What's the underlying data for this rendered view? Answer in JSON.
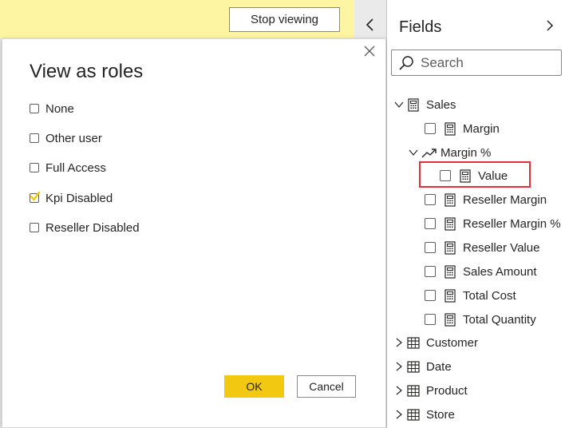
{
  "viewing_bar": {
    "stop_label": "Stop viewing"
  },
  "dialog": {
    "title": "View as roles",
    "roles": [
      {
        "label": "None",
        "checked": false
      },
      {
        "label": "Other user",
        "checked": false
      },
      {
        "label": "Full Access",
        "checked": false
      },
      {
        "label": "Kpi Disabled",
        "checked": true
      },
      {
        "label": "Reseller Disabled",
        "checked": false
      }
    ],
    "ok_label": "OK",
    "cancel_label": "Cancel"
  },
  "fields": {
    "title": "Fields",
    "search_placeholder": "Search",
    "tables": {
      "sales": "Sales",
      "customer": "Customer",
      "date": "Date",
      "product": "Product",
      "store": "Store"
    },
    "sales_fields": {
      "margin": "Margin",
      "margin_pct": "Margin %",
      "value": "Value",
      "reseller_margin": "Reseller Margin",
      "reseller_margin_pct": "Reseller Margin %",
      "reseller_value": "Reseller Value",
      "sales_amount": "Sales Amount",
      "total_cost": "Total Cost",
      "total_quantity": "Total Quantity"
    }
  },
  "colors": {
    "accent_yellow": "#f2c811",
    "banner_yellow": "#fdf5a2",
    "highlight_red": "#e3313a"
  }
}
